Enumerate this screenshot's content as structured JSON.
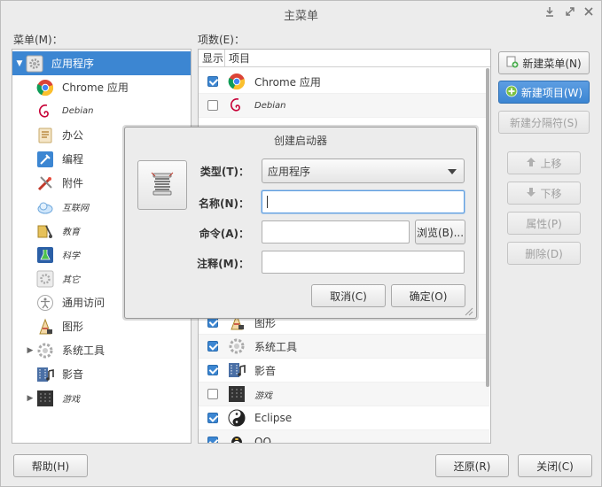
{
  "window": {
    "title": "主菜单"
  },
  "menus_label": "菜单(M)：",
  "items_label": "项数(E)：",
  "menu_tree": [
    {
      "label": "应用程序",
      "icon": "gear-icon",
      "expanded": true,
      "selected": true,
      "small": false
    },
    {
      "label": "Chrome 应用",
      "icon": "chrome-icon",
      "small": false
    },
    {
      "label": "Debian",
      "icon": "debian-icon",
      "small": true
    },
    {
      "label": "办公",
      "icon": "office-icon",
      "small": false
    },
    {
      "label": "编程",
      "icon": "programming-icon",
      "small": false
    },
    {
      "label": "附件",
      "icon": "accessories-icon",
      "small": false
    },
    {
      "label": "互联网",
      "icon": "internet-icon",
      "small": true
    },
    {
      "label": "教育",
      "icon": "education-icon",
      "small": true
    },
    {
      "label": "科学",
      "icon": "science-icon",
      "small": true
    },
    {
      "label": "其它",
      "icon": "other-icon",
      "small": true
    },
    {
      "label": "通用访问",
      "icon": "accessibility-icon",
      "small": false
    },
    {
      "label": "图形",
      "icon": "graphics-icon",
      "small": false
    },
    {
      "label": "系统工具",
      "icon": "system-tools-icon",
      "collapsed": true,
      "small": false
    },
    {
      "label": "影音",
      "icon": "multimedia-icon",
      "small": false
    },
    {
      "label": "游戏",
      "icon": "games-icon",
      "collapsed": true,
      "small": true
    }
  ],
  "items_table": {
    "col_show": "显示",
    "col_item": "项目",
    "rows": [
      {
        "label": "Chrome 应用",
        "checked": true,
        "icon": "chrome-icon",
        "small": false
      },
      {
        "label": "Debian",
        "checked": false,
        "icon": "debian-icon",
        "small": true
      },
      {
        "label": "图形",
        "checked": true,
        "icon": "graphics-icon",
        "small": false
      },
      {
        "label": "系统工具",
        "checked": true,
        "icon": "system-tools-icon",
        "small": false
      },
      {
        "label": "影音",
        "checked": true,
        "icon": "multimedia-icon",
        "small": false
      },
      {
        "label": "游戏",
        "checked": false,
        "icon": "games-icon",
        "small": true
      },
      {
        "label": "Eclipse",
        "checked": true,
        "icon": "eclipse-icon",
        "small": false
      },
      {
        "label": "QQ",
        "checked": true,
        "icon": "qq-icon",
        "small": false
      }
    ]
  },
  "side_buttons": {
    "new_menu": "新建菜单(N)",
    "new_item": "新建项目(W)",
    "new_separator": "新建分隔符(S)",
    "move_up": "上移",
    "move_down": "下移",
    "properties": "属性(P)",
    "delete": "删除(D)"
  },
  "bottom_buttons": {
    "help": "帮助(H)",
    "revert": "还原(R)",
    "close": "关闭(C)"
  },
  "dialog": {
    "title": "创建启动器",
    "type_label": "类型(T)：",
    "type_value": "应用程序",
    "name_label": "名称(N)：",
    "name_value": "",
    "command_label": "命令(A)：",
    "command_value": "",
    "browse_button": "浏览(B)...",
    "comment_label": "注释(M)：",
    "comment_value": "",
    "cancel_button": "取消(C)",
    "ok_button": "确定(O)"
  }
}
